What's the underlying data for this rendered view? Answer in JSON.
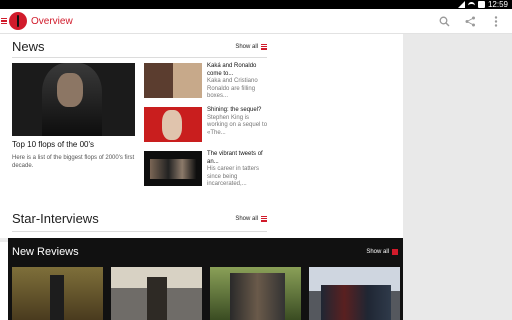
{
  "status_bar": {
    "time": "12:59"
  },
  "app_bar": {
    "title": "Overview",
    "actions": [
      "search-icon",
      "share-icon",
      "more-vert-icon"
    ],
    "accent": "#d11b2b"
  },
  "news": {
    "title": "News",
    "show_all": "Show all",
    "lead": {
      "title": "Top 10 flops of the 00's",
      "text": "Here is a list of the biggest flops of 2000's first decade."
    },
    "items": [
      {
        "title": "Kaká and Ronaldo come to...",
        "body": "Kaka and Cristiano Ronaldo are filling boxes..."
      },
      {
        "title": "Shining: the sequel?",
        "body": "Stephen King is working on a sequel to «The..."
      },
      {
        "title": "The vibrant tweets of an...",
        "body": "His career in tatters since being incarcerated,..."
      }
    ]
  },
  "star_interviews": {
    "title": "Star-Interviews",
    "show_all": "Show all"
  },
  "reviews": {
    "title": "New Reviews",
    "show_all": "Show all"
  }
}
